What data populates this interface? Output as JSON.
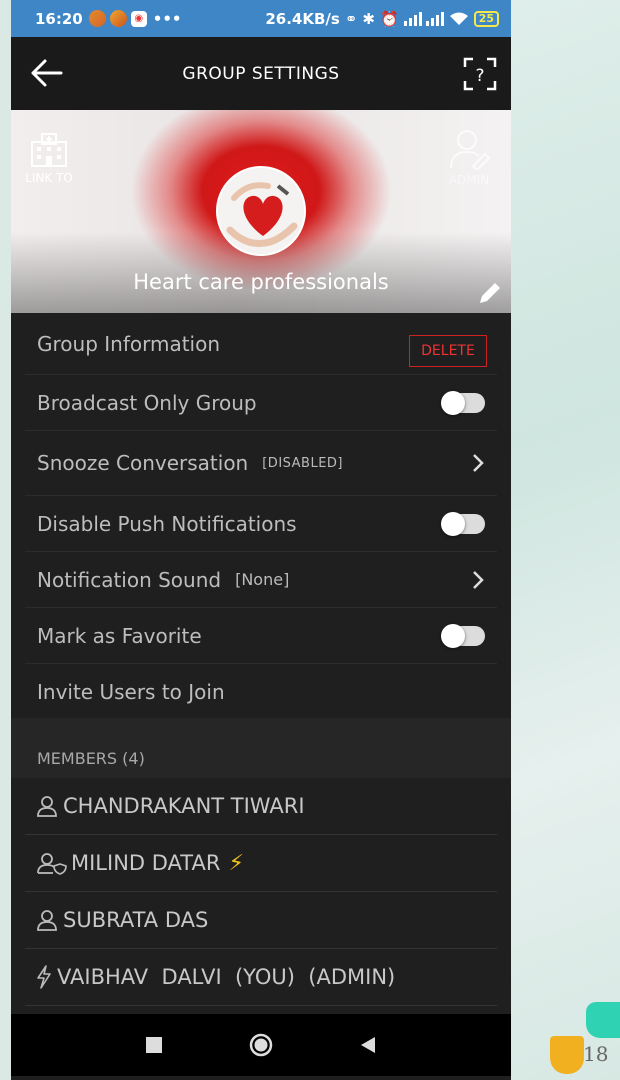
{
  "status_bar": {
    "time": "16:20",
    "more": "•••",
    "net_speed": "26.4KB/s",
    "battery": "25"
  },
  "toolbar": {
    "title": "GROUP SETTINGS",
    "back_icon": "arrow-left-icon",
    "scan_icon": "qr-scan-icon"
  },
  "banner": {
    "link_to_label": "LINK TO",
    "admin_label": "ADMIN",
    "group_name": "Heart care professionals"
  },
  "settings": {
    "group_information": "Group Information",
    "delete_label": "DELETE",
    "broadcast_only": "Broadcast Only Group",
    "broadcast_only_on": false,
    "snooze": "Snooze Conversation",
    "snooze_status": "[DISABLED]",
    "disable_push": "Disable Push Notifications",
    "disable_push_on": false,
    "notification_sound": "Notification Sound",
    "notification_sound_value": "[None]",
    "mark_favorite": "Mark as Favorite",
    "mark_favorite_on": false,
    "invite_users": "Invite Users to Join"
  },
  "members": {
    "header": "MEMBERS (4)",
    "list": [
      {
        "name": "CHANDRAKANT TIWARI",
        "icon": "user-icon"
      },
      {
        "name": "MILIND DATAR",
        "icon": "user-shield-icon",
        "badge": "⚡"
      },
      {
        "name": "SUBRATA DAS",
        "icon": "user-icon"
      },
      {
        "name": "VAIBHAV  DALVI  (YOU)  (ADMIN)",
        "icon": "bolt-outline-icon"
      }
    ]
  },
  "background": {
    "corner_number": "18"
  },
  "colors": {
    "status_bar": "#3f86c6",
    "page_bg": "#1f1f1f",
    "delete_red": "#e33333",
    "bolt_yellow": "#f2c21b"
  }
}
